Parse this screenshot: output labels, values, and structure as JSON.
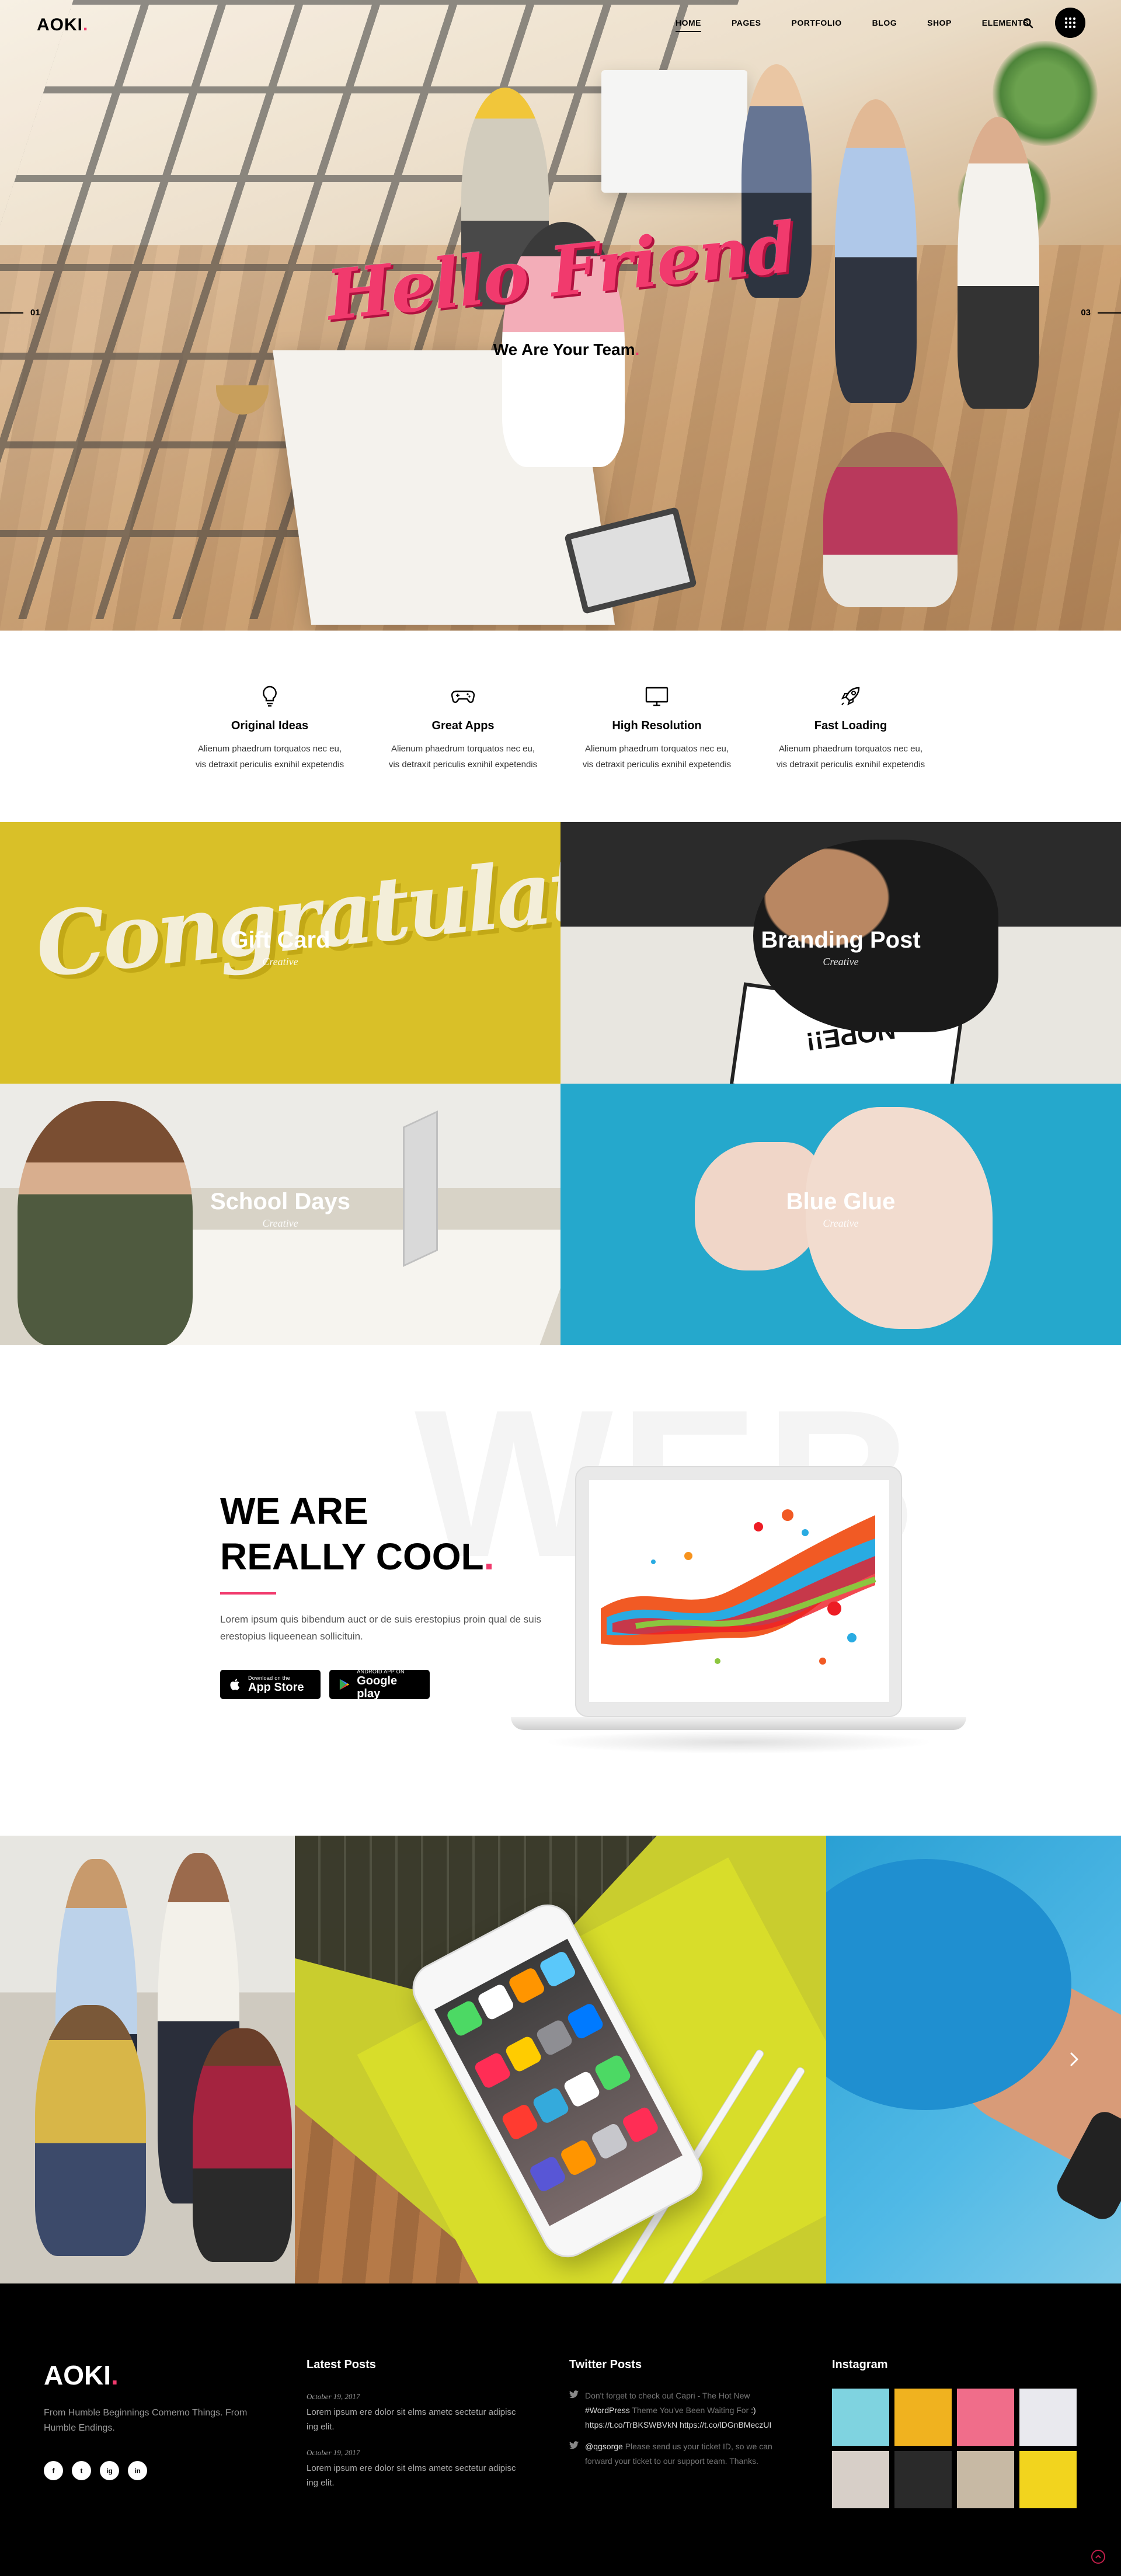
{
  "brand": {
    "name": "AOKI",
    "dot": ".",
    "accent": "#f13a6d"
  },
  "nav": {
    "items": [
      "HOME",
      "PAGES",
      "PORTFOLIO",
      "BLOG",
      "SHOP",
      "ELEMENTS"
    ],
    "active": "HOME",
    "icons": [
      "search-icon",
      "grid-menu-icon"
    ]
  },
  "hero": {
    "script_title": "Hello Friend",
    "subtitle": "We Are Your Team",
    "subtitle_dot": ".",
    "slide_left": "01",
    "slide_right": "03"
  },
  "features": [
    {
      "icon": "lightbulb-icon",
      "title": "Original Ideas",
      "line1": "Alienum phaedrum torquatos nec eu,",
      "line2": "vis detraxit periculis exnihil expetendis"
    },
    {
      "icon": "gamepad-icon",
      "title": "Great Apps",
      "line1": "Alienum phaedrum torquatos nec eu,",
      "line2": "vis detraxit periculis exnihil expetendis"
    },
    {
      "icon": "monitor-icon",
      "title": "High Resolution",
      "line1": "Alienum phaedrum torquatos nec eu,",
      "line2": "vis detraxit periculis exnihil expetendis"
    },
    {
      "icon": "rocket-icon",
      "title": "Fast Loading",
      "line1": "Alienum phaedrum torquatos nec eu,",
      "line2": "vis detraxit periculis exnihil expetendis"
    }
  ],
  "portfolio": [
    {
      "title": "Gift Card",
      "category": "Creative",
      "art": "Congratulations"
    },
    {
      "title": "Branding Post",
      "category": "Creative",
      "art": "NOPE!!"
    },
    {
      "title": "School Days",
      "category": "Creative"
    },
    {
      "title": "Blue Glue",
      "category": "Creative"
    }
  ],
  "about": {
    "bg_word": "WEB",
    "heading_line1": "WE ARE",
    "heading_line2": "REALLY COOL",
    "heading_dot": ".",
    "paragraph": "Lorem ipsum quis bibendum auct or de suis erestopius proin qual de suis erestopius liqueenean sollicituin.",
    "app_store_small": "Download on the",
    "app_store_big": "App Store",
    "google_small": "ANDROID APP ON",
    "google_big": "Google play"
  },
  "footer": {
    "tagline": "From Humble Beginnings Comemo Things. From Humble Endings.",
    "socials": [
      "f",
      "t",
      "ig",
      "in"
    ],
    "latest_posts_title": "Latest Posts",
    "posts": [
      {
        "date": "October 19, 2017",
        "text": "Lorem ipsum ere dolor sit elms ametc sectetur adipisc ing elit."
      },
      {
        "date": "October 19, 2017",
        "text": "Lorem ipsum ere dolor sit elms ametc sectetur adipisc ing elit."
      }
    ],
    "twitter_title": "Twitter Posts",
    "tweets": [
      {
        "pre": "Don't forget to check out Capri - The Hot New ",
        "hl1": "#WordPress",
        "mid": " Theme You've Been Waiting For ",
        "hl2": ":) https://t.co/TrBKSWBVkN https://t.co/lDGnBMeczUI"
      },
      {
        "hl1": "@qgsorge",
        "mid": " Please send us your ticket ID, so we can forward your ticket to our support team. Thanks."
      }
    ],
    "instagram_title": "Instagram",
    "instagram_colors": [
      "#7fd3e0",
      "#f0b21f",
      "#f06d8a",
      "#e9e9ee",
      "#d7cfc8",
      "#2a2a2a",
      "#c7b9a4",
      "#f2d41e"
    ]
  }
}
